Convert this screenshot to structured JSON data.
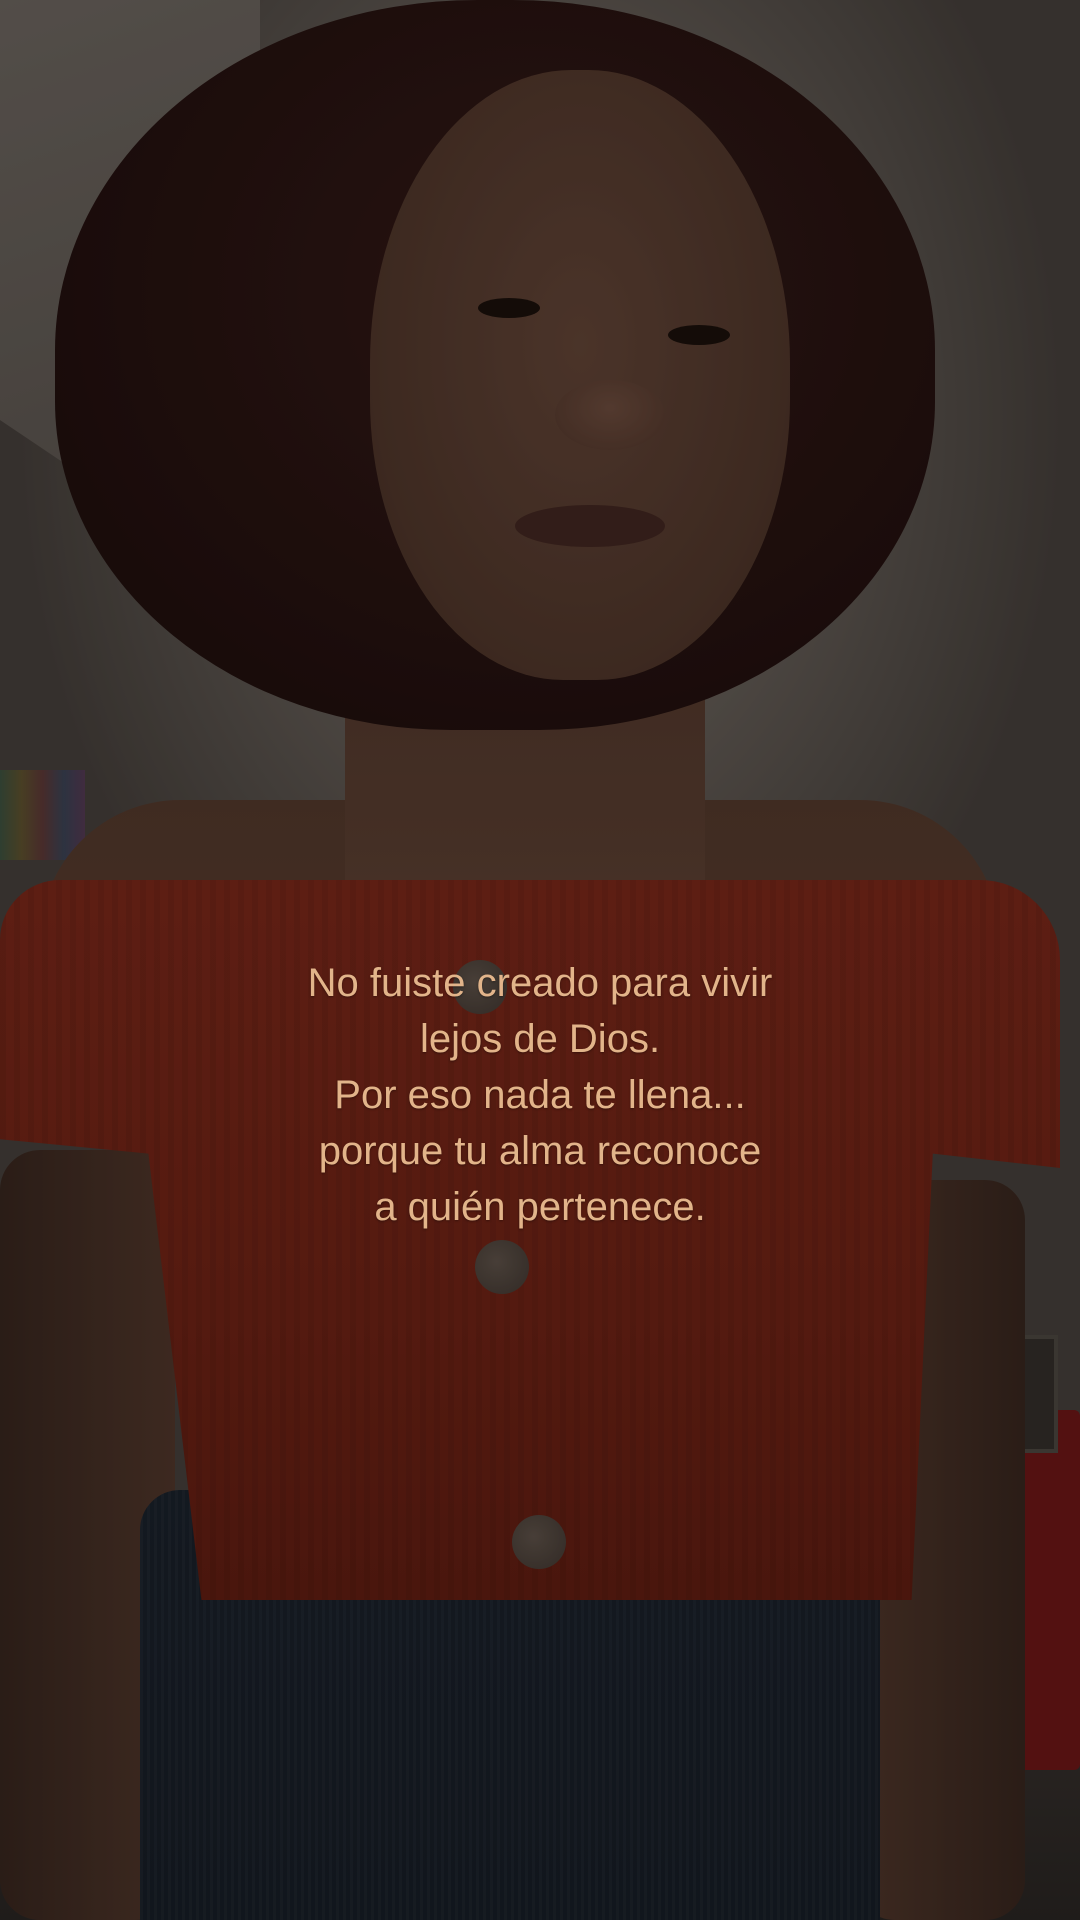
{
  "caption": {
    "lines": [
      "No fuiste creado para vivir",
      "lejos de Dios.",
      "Por eso nada te llena...",
      "porque tu alma reconoce",
      "a quién pertenece."
    ]
  },
  "colors": {
    "caption_text": "#e2b48a",
    "top_red": "#7d2718",
    "jeans_blue": "#1d2530",
    "overlay": "rgba(0,0,0,0.32)"
  }
}
